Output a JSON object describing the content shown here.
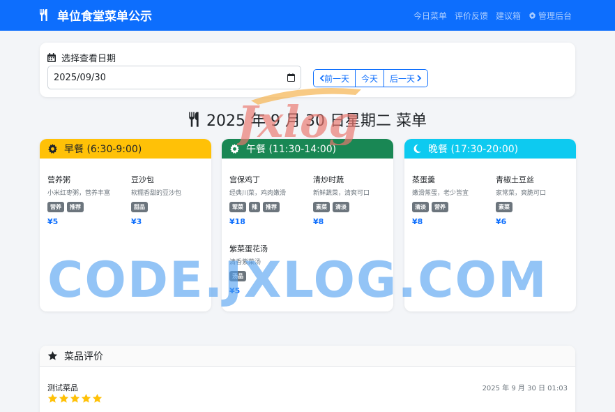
{
  "navbar": {
    "brand": "单位食堂菜单公示",
    "links": [
      "今日菜单",
      "评价反馈",
      "建议箱",
      "管理后台"
    ]
  },
  "date_picker": {
    "label": "选择查看日期",
    "value": "2025/09/30",
    "prev": "前一天",
    "today": "今天",
    "next": "后一天"
  },
  "heading": "2025 年 9 月 30 日星期二 菜单",
  "meals": [
    {
      "title": "早餐 (6:30-9:00)",
      "dishes": [
        {
          "name": "营养粥",
          "desc": "小米红枣粥，营养丰富",
          "tags": [
            "营养",
            "推荐"
          ],
          "price": "¥5"
        },
        {
          "name": "豆沙包",
          "desc": "软糯香甜的豆沙包",
          "tags": [
            "甜品"
          ],
          "price": "¥3"
        }
      ]
    },
    {
      "title": "午餐 (11:30-14:00)",
      "dishes": [
        {
          "name": "宫保鸡丁",
          "desc": "经典川菜，鸡肉嫩滑",
          "tags": [
            "荤菜",
            "辣",
            "推荐"
          ],
          "price": "¥18"
        },
        {
          "name": "清炒时蔬",
          "desc": "新鲜蔬菜，清爽可口",
          "tags": [
            "素菜",
            "清淡"
          ],
          "price": "¥8"
        },
        {
          "name": "紫菜蛋花汤",
          "desc": "清香紫菜汤",
          "tags": [
            "汤品"
          ],
          "price": "¥5"
        }
      ]
    },
    {
      "title": "晚餐 (17:30-20:00)",
      "dishes": [
        {
          "name": "蒸蛋羹",
          "desc": "嫩滑蒸蛋，老少皆宜",
          "tags": [
            "清淡",
            "营养"
          ],
          "price": "¥8"
        },
        {
          "name": "青椒土豆丝",
          "desc": "家常菜，爽脆可口",
          "tags": [
            "素菜"
          ],
          "price": "¥6"
        }
      ]
    }
  ],
  "reviews": {
    "title": "菜品评价",
    "items": [
      {
        "dish": "测试菜品",
        "time": "2025 年 9 月 30 日 01:03",
        "stars": 5
      }
    ]
  },
  "watermark": {
    "text": "CODE.JXLOG.COM",
    "logo": "Jxlog"
  },
  "colors": {
    "primary": "#0d6efd",
    "breakfast": "#ffc107",
    "lunch": "#198754",
    "dinner": "#0dcaf0",
    "star": "#ffc107"
  }
}
